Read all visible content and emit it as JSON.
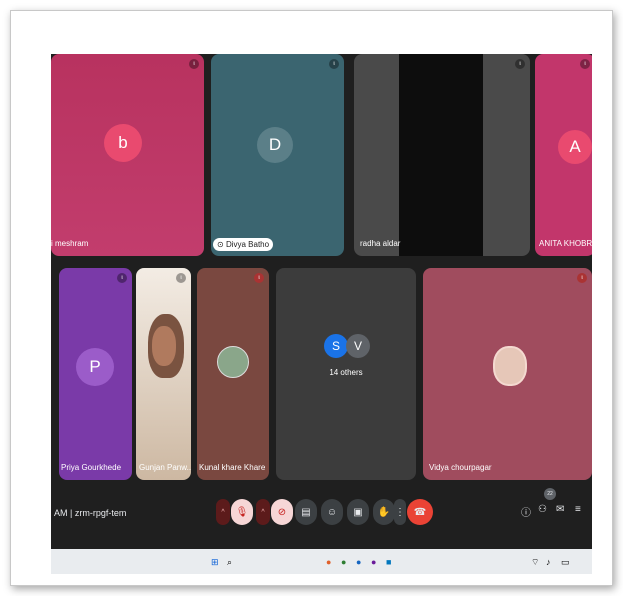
{
  "tiles": [
    {
      "name": "i meshram",
      "initial": "b",
      "color": "#c2366b"
    },
    {
      "name": "Divya Batho",
      "initial": "D",
      "color": "#3b6570"
    },
    {
      "name": "radha aldar",
      "initial": "",
      "color": "#4a4a4a"
    },
    {
      "name": "ANITA KHOBRAGA",
      "initial": "A",
      "color": "#c2366b"
    },
    {
      "name": "Priya Gourkhede",
      "initial": "P",
      "color": "#7a3aa8"
    },
    {
      "name": "Gunjan Panw...",
      "initial": "",
      "color": "#d8c8b8"
    },
    {
      "name": "Kunal khare Khare",
      "initial": "",
      "color": "#7a4840"
    },
    {
      "name": "14 others",
      "initials": [
        "S",
        "V"
      ],
      "color": "#3c3c3c"
    },
    {
      "name": "Vidya chourpagar",
      "initial": "",
      "color": "#a04c5e"
    }
  ],
  "meeting": {
    "info": "AM | zrm-rpgf-tem"
  },
  "participants_badge": "22"
}
